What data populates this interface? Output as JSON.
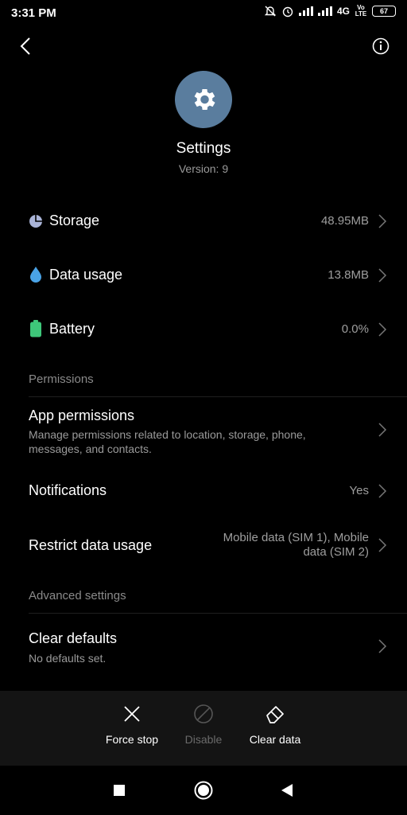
{
  "status_bar": {
    "time": "3:31 PM",
    "network": "4G",
    "volte": "Vo LTE",
    "battery": "67"
  },
  "header": {
    "back_icon": "back-arrow-icon",
    "info_icon": "info-icon"
  },
  "app": {
    "name": "Settings",
    "version": "Version: 9",
    "icon": "gear-icon",
    "icon_bg": "#5a7d9e"
  },
  "usage": [
    {
      "label": "Storage",
      "value": "48.95MB",
      "icon": "pie-chart-icon",
      "color": "#aab4d8"
    },
    {
      "label": "Data usage",
      "value": "13.8MB",
      "icon": "droplet-icon",
      "color": "#4aa3e6"
    },
    {
      "label": "Battery",
      "value": "0.0%",
      "icon": "battery-icon",
      "color": "#3ec77a"
    }
  ],
  "permissions": {
    "header": "Permissions",
    "app_permissions": {
      "label": "App permissions",
      "desc_line1": "Manage permissions related to location, storage, phone,",
      "desc_line2": "messages, and contacts."
    },
    "notifications": {
      "label": "Notifications",
      "value": "Yes"
    },
    "restrict": {
      "label": "Restrict data usage",
      "value_line1": "Mobile data (SIM 1), Mobile",
      "value_line2": "data (SIM 2)"
    }
  },
  "advanced": {
    "header": "Advanced settings",
    "clear_defaults": {
      "label": "Clear defaults",
      "desc": "No defaults set."
    }
  },
  "actions": {
    "force_stop": "Force stop",
    "disable": "Disable",
    "clear_data": "Clear data"
  }
}
